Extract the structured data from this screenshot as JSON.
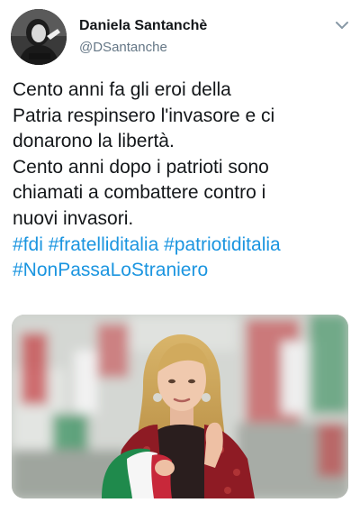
{
  "tweet": {
    "author": {
      "display_name": "Daniela Santanchè",
      "handle": "@DSantanche",
      "avatar_overlay_text": "Daniela Santanchè"
    },
    "text_lines": [
      "Cento anni fa gli eroi della",
      "Patria respinsero l'invasore e ci",
      "donarono la libertà.",
      "Cento anni dopo i patrioti sono",
      "chiamati a combattere contro i",
      "nuovi invasori."
    ],
    "hashtags": [
      "#fdi",
      "#fratelliditalia",
      "#patriotiditalia",
      "#NonPassaLoStraniero"
    ],
    "menu_icon": "chevron-down-icon",
    "media": {
      "type": "video-thumbnail"
    }
  },
  "colors": {
    "text": "#14171a",
    "secondary": "#657786",
    "link": "#1b95e0",
    "flag_green": "#009246",
    "flag_red": "#ce2b37",
    "background": "#ffffff"
  }
}
